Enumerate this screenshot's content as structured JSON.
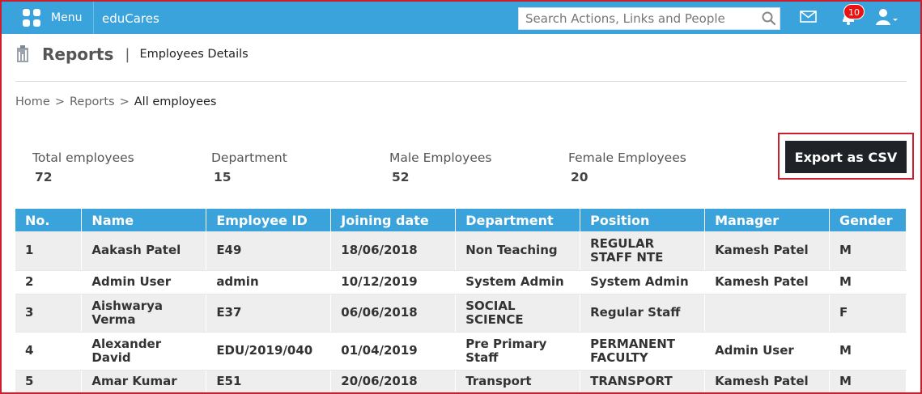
{
  "topbar": {
    "menu_label": "Menu",
    "brand": "eduCares",
    "search_placeholder": "Search Actions, Links and People",
    "notification_count": "10",
    "accent_color": "#3ba3dc"
  },
  "header": {
    "title": "Reports",
    "separator": "|",
    "subtitle": "Employees Details"
  },
  "breadcrumb": {
    "home": "Home",
    "sep1": ">",
    "reports": "Reports",
    "sep2": ">",
    "current": "All employees"
  },
  "stats": {
    "total_label": "Total employees",
    "total_value": "72",
    "dept_label": "Department",
    "dept_value": "15",
    "male_label": "Male Employees",
    "male_value": "52",
    "female_label": "Female Employees",
    "female_value": "20"
  },
  "export_label": "Export as CSV",
  "table": {
    "headers": [
      "No.",
      "Name",
      "Employee ID",
      "Joining date",
      "Department",
      "Position",
      "Manager",
      "Gender"
    ],
    "rows": [
      [
        "1",
        "Aakash Patel",
        "E49",
        "18/06/2018",
        "Non Teaching",
        "REGULAR STAFF NTE",
        "Kamesh Patel",
        "M"
      ],
      [
        "2",
        "Admin User",
        "admin",
        "10/12/2019",
        "System Admin",
        "System Admin",
        "Kamesh Patel",
        "M"
      ],
      [
        "3",
        "Aishwarya Verma",
        "E37",
        "06/06/2018",
        "SOCIAL SCIENCE",
        "Regular Staff",
        "",
        "F"
      ],
      [
        "4",
        "Alexander David",
        "EDU/2019/040",
        "01/04/2019",
        "Pre Primary Staff",
        "PERMANENT FACULTY",
        "Admin User",
        "M"
      ],
      [
        "5",
        "Amar Kumar",
        "E51",
        "20/06/2018",
        "Transport",
        "TRANSPORT",
        "Kamesh Patel",
        "M"
      ]
    ]
  }
}
